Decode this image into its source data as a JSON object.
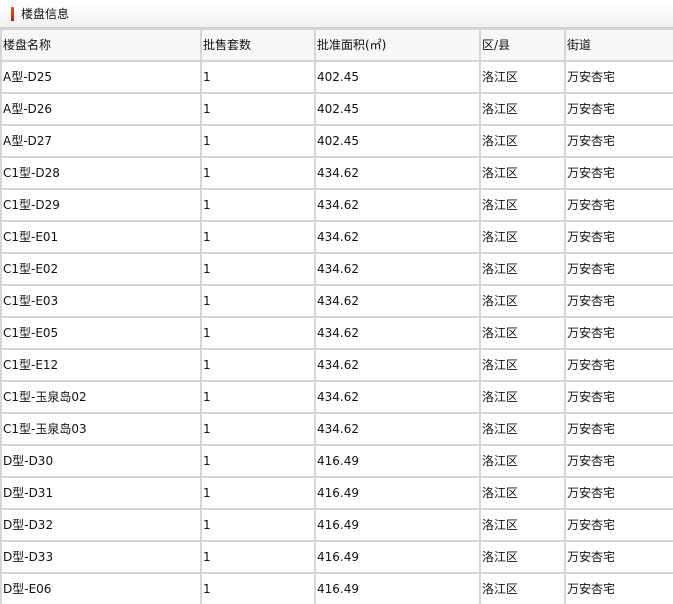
{
  "panel": {
    "title": "楼盘信息",
    "accent_color": "#c0330f"
  },
  "table": {
    "columns": [
      "楼盘名称",
      "批售套数",
      "批准面积(㎡)",
      "区/县",
      "街道"
    ],
    "rows": [
      [
        "A型-D25",
        "1",
        "402.45",
        "洛江区",
        "万安杏宅"
      ],
      [
        "A型-D26",
        "1",
        "402.45",
        "洛江区",
        "万安杏宅"
      ],
      [
        "A型-D27",
        "1",
        "402.45",
        "洛江区",
        "万安杏宅"
      ],
      [
        "C1型-D28",
        "1",
        "434.62",
        "洛江区",
        "万安杏宅"
      ],
      [
        "C1型-D29",
        "1",
        "434.62",
        "洛江区",
        "万安杏宅"
      ],
      [
        "C1型-E01",
        "1",
        "434.62",
        "洛江区",
        "万安杏宅"
      ],
      [
        "C1型-E02",
        "1",
        "434.62",
        "洛江区",
        "万安杏宅"
      ],
      [
        "C1型-E03",
        "1",
        "434.62",
        "洛江区",
        "万安杏宅"
      ],
      [
        "C1型-E05",
        "1",
        "434.62",
        "洛江区",
        "万安杏宅"
      ],
      [
        "C1型-E12",
        "1",
        "434.62",
        "洛江区",
        "万安杏宅"
      ],
      [
        "C1型-玉泉岛02",
        "1",
        "434.62",
        "洛江区",
        "万安杏宅"
      ],
      [
        "C1型-玉泉岛03",
        "1",
        "434.62",
        "洛江区",
        "万安杏宅"
      ],
      [
        "D型-D30",
        "1",
        "416.49",
        "洛江区",
        "万安杏宅"
      ],
      [
        "D型-D31",
        "1",
        "416.49",
        "洛江区",
        "万安杏宅"
      ],
      [
        "D型-D32",
        "1",
        "416.49",
        "洛江区",
        "万安杏宅"
      ],
      [
        "D型-D33",
        "1",
        "416.49",
        "洛江区",
        "万安杏宅"
      ],
      [
        "D型-E06",
        "1",
        "416.49",
        "洛江区",
        "万安杏宅"
      ]
    ]
  }
}
